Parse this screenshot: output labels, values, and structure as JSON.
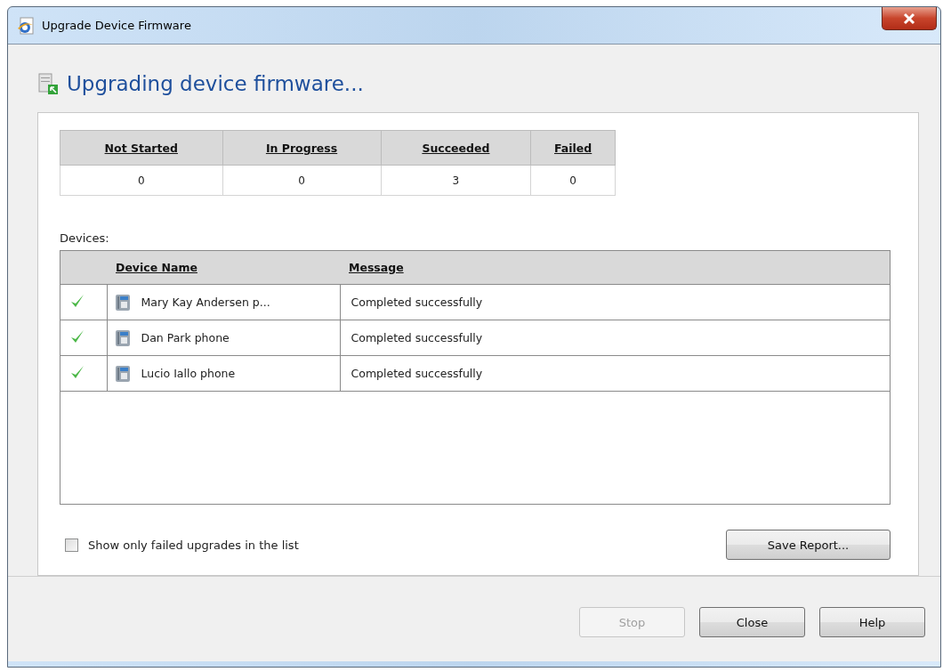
{
  "window": {
    "title": "Upgrade Device Firmware"
  },
  "heading": "Upgrading device firmware...",
  "summary": {
    "columns": [
      "Not Started",
      "In Progress",
      "Succeeded",
      "Failed"
    ],
    "values": [
      "0",
      "0",
      "3",
      "0"
    ]
  },
  "devices": {
    "label": "Devices:",
    "columns": [
      "Device Name",
      "Message"
    ],
    "rows": [
      {
        "succeeded": true,
        "name": "Mary Kay Andersen p...",
        "message": "Completed successfully"
      },
      {
        "succeeded": true,
        "name": "Dan Park phone",
        "message": "Completed successfully"
      },
      {
        "succeeded": true,
        "name": "Lucio Iallo phone",
        "message": "Completed successfully"
      }
    ]
  },
  "filter": {
    "label": "Show only failed upgrades in the list",
    "checked": false
  },
  "save_button": {
    "label": "Save Report...",
    "disabled": false
  },
  "buttons": [
    {
      "label": "Stop",
      "disabled": true
    },
    {
      "label": "Close",
      "disabled": false
    },
    {
      "label": "Help",
      "disabled": false
    }
  ]
}
